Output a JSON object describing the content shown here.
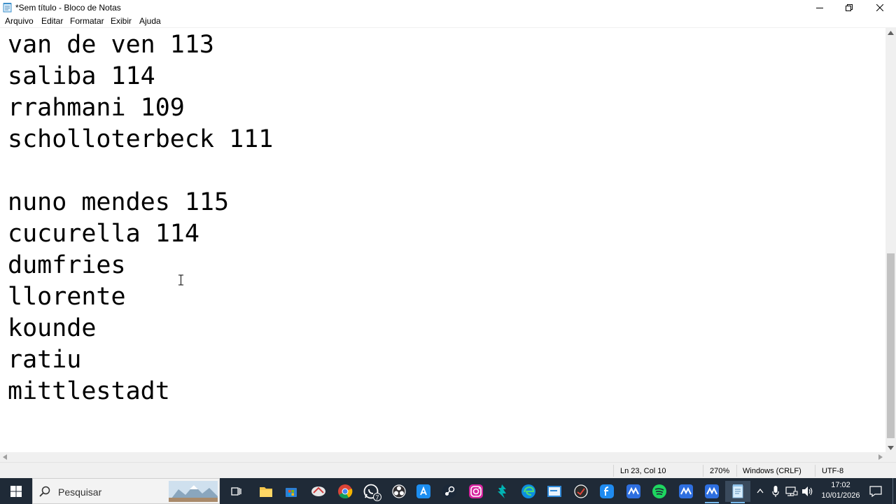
{
  "window": {
    "title": "*Sem título - Bloco de Notas",
    "buttons": {
      "minimize": "minimize-icon",
      "maximize": "restore-icon",
      "close": "close-icon"
    }
  },
  "menu": [
    "Arquivo",
    "Editar",
    "Formatar",
    "Exibir",
    "Ajuda"
  ],
  "editor": {
    "lines": [
      "van de ven 113",
      "saliba 114",
      "rrahmani 109",
      "scholloterbeck 111",
      "",
      "nuno mendes 115",
      "cucurella 114",
      "dumfries",
      "llorente",
      "kounde",
      "ratiu",
      "mittlestadt"
    ]
  },
  "status": {
    "position": "Ln 23, Col 10",
    "zoom": "270%",
    "line_ending": "Windows (CRLF)",
    "encoding": "UTF-8"
  },
  "taskbar": {
    "search_placeholder": "Pesquisar",
    "apps": [
      {
        "name": "task-view-icon"
      },
      {
        "name": "file-explorer-icon"
      },
      {
        "name": "microsoft-store-icon"
      },
      {
        "name": "app-icon"
      },
      {
        "name": "chrome-icon"
      },
      {
        "name": "whatsapp-icon",
        "badge": "7"
      },
      {
        "name": "obs-icon"
      },
      {
        "name": "app-store-icon"
      },
      {
        "name": "steam-icon"
      },
      {
        "name": "instagram-icon"
      },
      {
        "name": "app-icon"
      },
      {
        "name": "edge-icon"
      },
      {
        "name": "app-icon"
      },
      {
        "name": "app-icon"
      },
      {
        "name": "app-icon"
      },
      {
        "name": "app-icon"
      },
      {
        "name": "spotify-icon"
      },
      {
        "name": "app-icon"
      },
      {
        "name": "app-icon"
      },
      {
        "name": "notepad-icon"
      }
    ],
    "clock": {
      "time": "17:02",
      "date": "10/01/2026"
    }
  },
  "colors": {
    "taskbar": "#1f2a37",
    "accent": "#76b9ed"
  }
}
